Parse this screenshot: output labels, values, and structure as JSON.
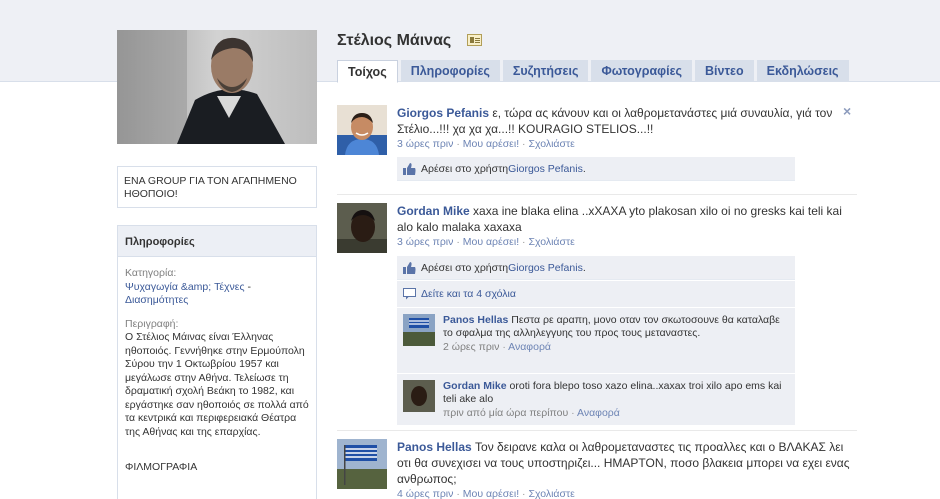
{
  "profile": {
    "name": "Στέλιος Μάινας",
    "about": "ΕΝΑ GROUP ΓΙΑ ΤΟΝ ΑΓΑΠΗΜΕΝΟ ΗΘΟΠΟΙΟ!"
  },
  "tabs": [
    "Τοίχος",
    "Πληροφορίες",
    "Συζητήσεις",
    "Φωτογραφίες",
    "Βίντεο",
    "Εκδηλώσεις"
  ],
  "info": {
    "header": "Πληροφορίες",
    "category_label": "Κατηγορία:",
    "category_link": "Ψυχαγωγία &amp; Τέχνες",
    "category_sep": " -",
    "category_sub": "Διασημότητες",
    "description_label": "Περιγραφή:",
    "description": "Ο Στέλιος Μάινας είναι Έλληνας ηθοποιός.  Γεννήθηκε στην Ερμούπολη Σύρου την  1 Οκτωβρίου 1957 και μεγάλωσε στην Αθήνα. Τελείωσε τη δραματική σχολή Βεάκη το 1982, και εργάστηκε σαν ηθοποιός σε πολλά από τα κεντρικά και περιφερειακά Θέατρα της Αθήνας και της επαρχίας.",
    "filmography": "ΦΙΛΜΟΓΡΑΦΙΑ"
  },
  "posts": [
    {
      "author": "Giorgos Pefanis",
      "text": " ε, τώρα ας κάνουν και οι λαθρομετανάστες μιά συναυλία, γιά τον Στέλιο...!!! χα χα χα...!! KOURAGIO STELIOS...!!",
      "time": "3 ώρες πριν",
      "like": "Μου αρέσει!",
      "comment": "Σχολιάστε",
      "likes_prefix": "Αρέσει στο χρήστη ",
      "likes_name": "Giorgos Pefanis",
      "likes_suffix": "."
    },
    {
      "author": "Gordan Mike",
      "text": " xaxa ine blaka elina ..xXAXA yto plakosan xilo oi no gresks kai teli kai alo kalo malaka xaxaxa",
      "time": "3 ώρες πριν",
      "like": "Μου αρέσει!",
      "comment": "Σχολιάστε",
      "likes_prefix": "Αρέσει στο χρήστη ",
      "likes_name": "Giorgos Pefanis",
      "likes_suffix": ".",
      "see_all": "Δείτε και τα 4 σχόλια",
      "comments": [
        {
          "author": "Panos Hellas",
          "text": " Πεστα ρε αραπη, μονο οταν τον σκωτοσουνε θα καταλαβε το σφαλμα της αλληλεγγυης του προς τους μεταναστες.",
          "time": "2 ώρες πριν",
          "report": "Αναφορά"
        },
        {
          "author": "Gordan Mike",
          "text": " oroti fora blepo toso xazo elina..xaxax troi xilo apo ems kai teli ake alo",
          "time": "πριν από μία ώρα περίπου",
          "report": "Αναφορά"
        }
      ]
    },
    {
      "author": "Panos Hellas",
      "text": " Τον δειρανε καλα οι λαθρομεταναστες τις πρoαλλες και ο ΒΛΑΚΑΣ λει οτι θα συνεχισει να τους υποστηριζει... ΗΜΑΡΤΟΝ, ποσο βλακεια μπορει να εχει ενας ανθρωπος;",
      "time": "4 ώρες πριν",
      "like": "Μου αρέσει!",
      "comment": "Σχολιάστε"
    }
  ],
  "icons": {
    "close": "close-icon",
    "like": "thumbs-up-icon",
    "comments": "comment-bubble-icon",
    "card": "business-card-icon"
  },
  "colors": {
    "link": "#3b5998",
    "tab_bg": "#d8dfea",
    "band_bg": "#eef0f5"
  }
}
